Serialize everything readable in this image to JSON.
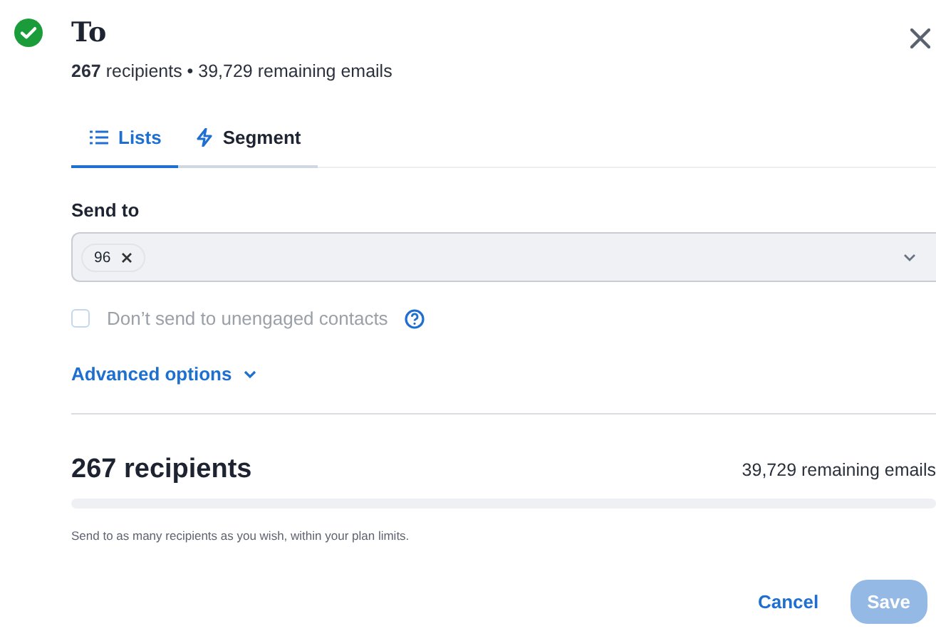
{
  "header": {
    "title": "To",
    "complete": true,
    "summary": "**267** recipients • 39,729 remaining emails"
  },
  "tabs": [
    {
      "label": "Lists",
      "kind": "list",
      "selected": true
    },
    {
      "label": "Segment",
      "kind": "bolt",
      "selected": false
    }
  ],
  "send_to": {
    "label": "Send to",
    "chips": [
      "96"
    ]
  },
  "unengaged": {
    "label": "Don’t send to unengaged contacts",
    "checked": false,
    "disabled": true
  },
  "advanced": {
    "label": "Advanced options",
    "expanded": false
  },
  "totals": {
    "recipients": "267 recipients",
    "remaining": "39,729 remaining emails",
    "level": 0,
    "note": "Send to as many recipients as you wish, within your plan limits."
  },
  "buttons": [
    {
      "label": "Cancel",
      "kind": "link",
      "disabled": false
    },
    {
      "label": "Save",
      "kind": "primary",
      "disabled": true
    }
  ]
}
